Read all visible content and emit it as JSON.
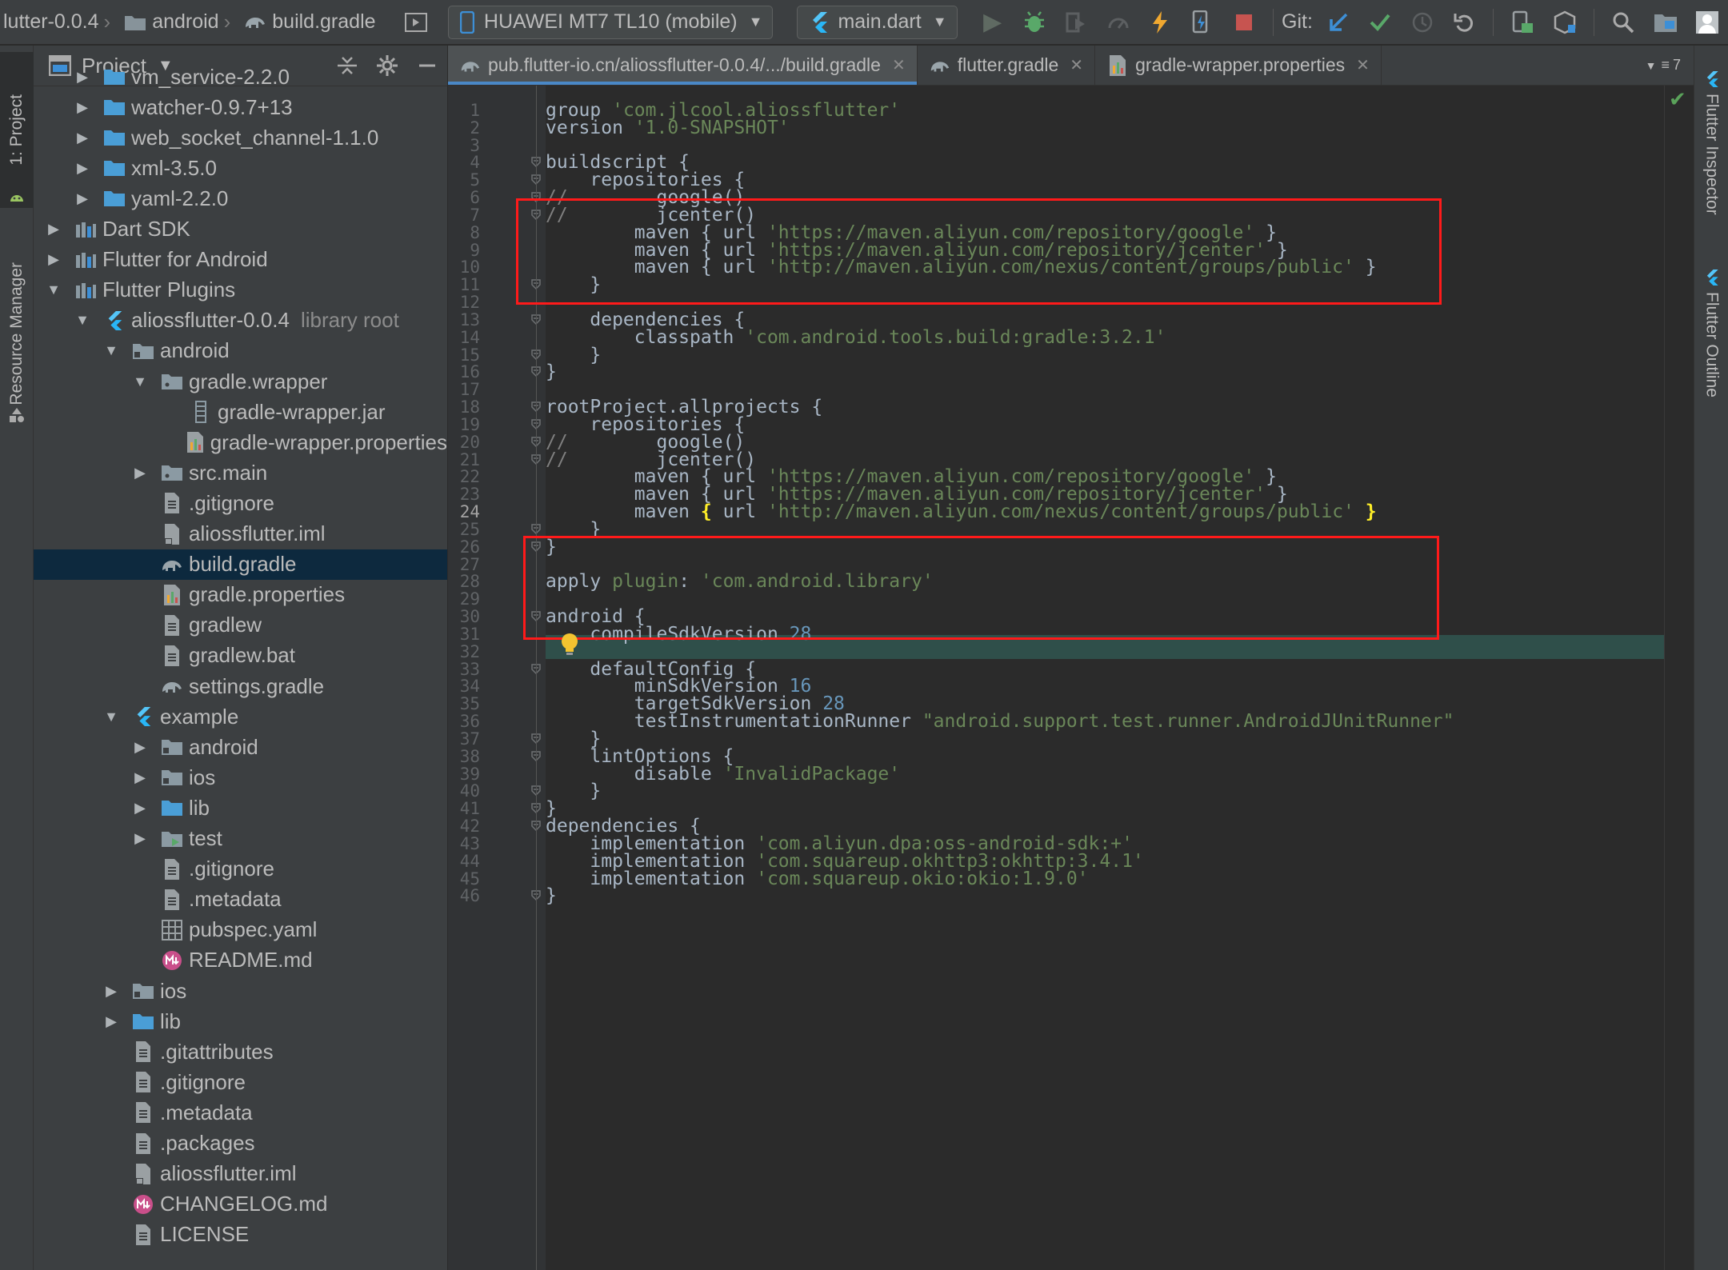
{
  "colors": {
    "accent": "#4a88c7",
    "highlight_box": "#ff1a1a",
    "selection": "#0d293e",
    "string": "#6a8759",
    "comment": "#808080",
    "number": "#6897bb",
    "keyword": "#cc7832"
  },
  "breadcrumbs": [
    "lutter-0.0.4",
    "android",
    "build.gradle"
  ],
  "toolbar": {
    "device": "HUAWEI MT7 TL10 (mobile)",
    "run_config": "main.dart",
    "git_label": "Git:"
  },
  "left_tabs": {
    "project": "1: Project",
    "resource_manager": "Resource Manager"
  },
  "right_tabs": {
    "inspector": "Flutter Inspector",
    "outline": "Flutter Outline"
  },
  "project_panel": {
    "title": "Project",
    "tree": [
      {
        "label": "vm_service-2.2.0",
        "depth": 2,
        "arrow": "right",
        "icon": "folder-icon"
      },
      {
        "label": "watcher-0.9.7+13",
        "depth": 2,
        "arrow": "right",
        "icon": "folder-icon"
      },
      {
        "label": "web_socket_channel-1.1.0",
        "depth": 2,
        "arrow": "right",
        "icon": "folder-icon"
      },
      {
        "label": "xml-3.5.0",
        "depth": 2,
        "arrow": "right",
        "icon": "folder-icon"
      },
      {
        "label": "yaml-2.2.0",
        "depth": 2,
        "arrow": "right",
        "icon": "folder-icon"
      },
      {
        "label": "Dart SDK",
        "depth": 1,
        "arrow": "right",
        "icon": "library-icon"
      },
      {
        "label": "Flutter for Android",
        "depth": 1,
        "arrow": "right",
        "icon": "library-icon"
      },
      {
        "label": "Flutter Plugins",
        "depth": 1,
        "arrow": "down",
        "icon": "library-icon"
      },
      {
        "label": "aliossflutter-0.0.4",
        "sub": "library root",
        "depth": 2,
        "arrow": "down",
        "icon": "flutter-icon"
      },
      {
        "label": "android",
        "depth": 3,
        "arrow": "down",
        "icon": "module-folder-icon"
      },
      {
        "label": "gradle.wrapper",
        "depth": 4,
        "arrow": "down",
        "icon": "package-folder-icon"
      },
      {
        "label": "gradle-wrapper.jar",
        "depth": 5,
        "arrow": "",
        "icon": "jar-file-icon"
      },
      {
        "label": "gradle-wrapper.properties",
        "depth": 5,
        "arrow": "",
        "icon": "properties-file-icon"
      },
      {
        "label": "src.main",
        "depth": 4,
        "arrow": "right",
        "icon": "package-folder-icon"
      },
      {
        "label": ".gitignore",
        "depth": 4,
        "arrow": "",
        "icon": "text-file-icon"
      },
      {
        "label": "aliossflutter.iml",
        "depth": 4,
        "arrow": "",
        "icon": "iml-file-icon"
      },
      {
        "label": "build.gradle",
        "depth": 4,
        "arrow": "",
        "icon": "gradle-file-icon",
        "selected": true
      },
      {
        "label": "gradle.properties",
        "depth": 4,
        "arrow": "",
        "icon": "properties-file-icon"
      },
      {
        "label": "gradlew",
        "depth": 4,
        "arrow": "",
        "icon": "text-file-icon"
      },
      {
        "label": "gradlew.bat",
        "depth": 4,
        "arrow": "",
        "icon": "text-file-icon"
      },
      {
        "label": "settings.gradle",
        "depth": 4,
        "arrow": "",
        "icon": "gradle-file-icon"
      },
      {
        "label": "example",
        "depth": 3,
        "arrow": "down",
        "icon": "flutter-icon"
      },
      {
        "label": "android",
        "depth": 4,
        "arrow": "right",
        "icon": "module-folder-icon"
      },
      {
        "label": "ios",
        "depth": 4,
        "arrow": "right",
        "icon": "module-folder-icon"
      },
      {
        "label": "lib",
        "depth": 4,
        "arrow": "right",
        "icon": "folder-icon"
      },
      {
        "label": "test",
        "depth": 4,
        "arrow": "right",
        "icon": "test-folder-icon"
      },
      {
        "label": ".gitignore",
        "depth": 4,
        "arrow": "",
        "icon": "text-file-icon"
      },
      {
        "label": ".metadata",
        "depth": 4,
        "arrow": "",
        "icon": "text-file-icon"
      },
      {
        "label": "pubspec.yaml",
        "depth": 4,
        "arrow": "",
        "icon": "yaml-file-icon"
      },
      {
        "label": "README.md",
        "depth": 4,
        "arrow": "",
        "icon": "markdown-file-icon"
      },
      {
        "label": "ios",
        "depth": 3,
        "arrow": "right",
        "icon": "module-folder-icon"
      },
      {
        "label": "lib",
        "depth": 3,
        "arrow": "right",
        "icon": "folder-icon"
      },
      {
        "label": ".gitattributes",
        "depth": 3,
        "arrow": "",
        "icon": "text-file-icon"
      },
      {
        "label": ".gitignore",
        "depth": 3,
        "arrow": "",
        "icon": "text-file-icon"
      },
      {
        "label": ".metadata",
        "depth": 3,
        "arrow": "",
        "icon": "text-file-icon"
      },
      {
        "label": ".packages",
        "depth": 3,
        "arrow": "",
        "icon": "text-file-icon"
      },
      {
        "label": "aliossflutter.iml",
        "depth": 3,
        "arrow": "",
        "icon": "iml-file-icon"
      },
      {
        "label": "CHANGELOG.md",
        "depth": 3,
        "arrow": "",
        "icon": "markdown-file-icon"
      },
      {
        "label": "LICENSE",
        "depth": 3,
        "arrow": "",
        "icon": "text-file-icon"
      }
    ]
  },
  "editor_tabs": [
    {
      "label": "pub.flutter-io.cn/aliossflutter-0.0.4/.../build.gradle",
      "icon": "gradle-file-icon",
      "active": true
    },
    {
      "label": "flutter.gradle",
      "icon": "gradle-file-icon",
      "active": false
    },
    {
      "label": "gradle-wrapper.properties",
      "icon": "properties-file-icon",
      "active": false
    }
  ],
  "tab_overflow_count": "7",
  "current_line": 24,
  "code_lines": [
    [
      [
        "group ",
        "p"
      ],
      [
        "'com.jlcool.aliossflutter'",
        "s"
      ]
    ],
    [
      [
        "version ",
        "p"
      ],
      [
        "'1.0-SNAPSHOT'",
        "s"
      ]
    ],
    [],
    [
      [
        "buildscript {",
        "p"
      ]
    ],
    [
      [
        "    repositories {",
        "p"
      ]
    ],
    [
      [
        "//",
        "c"
      ],
      [
        "        google()",
        "p"
      ]
    ],
    [
      [
        "//",
        "c"
      ],
      [
        "        jcenter()",
        "p"
      ]
    ],
    [
      [
        "        maven { url ",
        "p"
      ],
      [
        "'https://maven.aliyun.com/repository/google'",
        "s"
      ],
      [
        " }",
        "p"
      ]
    ],
    [
      [
        "        maven { url ",
        "p"
      ],
      [
        "'https://maven.aliyun.com/repository/jcenter'",
        "s"
      ],
      [
        " }",
        "p"
      ]
    ],
    [
      [
        "        maven { url ",
        "p"
      ],
      [
        "'http://maven.aliyun.com/nexus/content/groups/public'",
        "s"
      ],
      [
        " }",
        "p"
      ]
    ],
    [
      [
        "    }",
        "p"
      ]
    ],
    [],
    [
      [
        "    dependencies {",
        "p"
      ]
    ],
    [
      [
        "        classpath ",
        "p"
      ],
      [
        "'com.android.tools.build:gradle:3.2.1'",
        "s"
      ]
    ],
    [
      [
        "    }",
        "p"
      ]
    ],
    [
      [
        "}",
        "p"
      ]
    ],
    [],
    [
      [
        "rootProject.allprojects {",
        "p"
      ]
    ],
    [
      [
        "    repositories {",
        "p"
      ]
    ],
    [
      [
        "//",
        "c"
      ],
      [
        "        google()",
        "p"
      ]
    ],
    [
      [
        "//",
        "c"
      ],
      [
        "        jcenter()",
        "p"
      ]
    ],
    [
      [
        "        maven { url ",
        "p"
      ],
      [
        "'https://maven.aliyun.com/repository/google'",
        "s"
      ],
      [
        " }",
        "p"
      ]
    ],
    [
      [
        "        maven { url ",
        "p"
      ],
      [
        "'https://maven.aliyun.com/repository/jcenter'",
        "s"
      ],
      [
        " }",
        "p"
      ]
    ],
    [
      [
        "        maven ",
        "p"
      ],
      [
        "{",
        "br"
      ],
      [
        " url ",
        "p"
      ],
      [
        "'http://maven.aliyun.com/nexus/content/groups/public'",
        "s"
      ],
      [
        " ",
        "p"
      ],
      [
        "}",
        "br"
      ]
    ],
    [
      [
        "    }",
        "p"
      ]
    ],
    [
      [
        "}",
        "p"
      ]
    ],
    [],
    [
      [
        "apply ",
        "p"
      ],
      [
        "plugin",
        "s"
      ],
      [
        ": ",
        "p"
      ],
      [
        "'com.android.library'",
        "s"
      ]
    ],
    [],
    [
      [
        "android {",
        "p"
      ]
    ],
    [
      [
        "    compileSdkVersion ",
        "p"
      ],
      [
        "28",
        "n"
      ]
    ],
    [],
    [
      [
        "    defaultConfig {",
        "p"
      ]
    ],
    [
      [
        "        minSdkVersion ",
        "p"
      ],
      [
        "16",
        "n"
      ]
    ],
    [
      [
        "        targetSdkVersion ",
        "p"
      ],
      [
        "28",
        "n"
      ]
    ],
    [
      [
        "        testInstrumentationRunner ",
        "p"
      ],
      [
        "\"android.support.test.runner.AndroidJUnitRunner\"",
        "s"
      ]
    ],
    [
      [
        "    }",
        "p"
      ]
    ],
    [
      [
        "    lintOptions {",
        "p"
      ]
    ],
    [
      [
        "        disable ",
        "p"
      ],
      [
        "'InvalidPackage'",
        "s"
      ]
    ],
    [
      [
        "    }",
        "p"
      ]
    ],
    [
      [
        "}",
        "p"
      ]
    ],
    [
      [
        "dependencies {",
        "p"
      ]
    ],
    [
      [
        "    implementation ",
        "p"
      ],
      [
        "'com.aliyun.dpa:oss-android-sdk:+'",
        "s"
      ]
    ],
    [
      [
        "    implementation ",
        "p"
      ],
      [
        "'com.squareup.okhttp3:okhttp:3.4.1'",
        "s"
      ]
    ],
    [
      [
        "    implementation ",
        "p"
      ],
      [
        "'com.squareup.okio:okio:1.9.0'",
        "s"
      ]
    ],
    [
      [
        "}",
        "p"
      ]
    ]
  ],
  "fold_lines": [
    4,
    5,
    6,
    7,
    11,
    13,
    15,
    16,
    18,
    19,
    20,
    21,
    25,
    26,
    30,
    33,
    37,
    38,
    40,
    41,
    42,
    46
  ]
}
